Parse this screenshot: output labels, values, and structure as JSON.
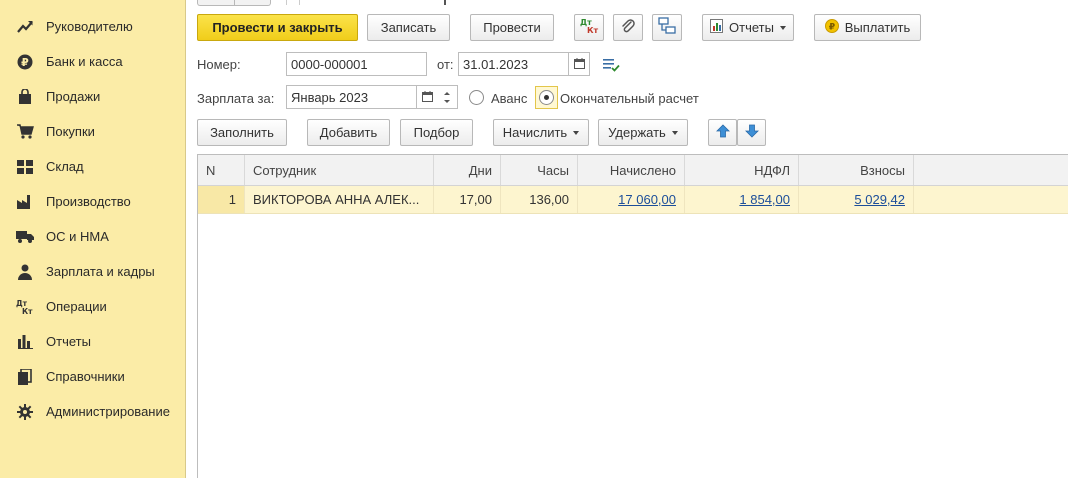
{
  "sidebar": {
    "items": [
      {
        "label": "Руководителю",
        "icon": "trend-chart-icon"
      },
      {
        "label": "Банк и касса",
        "icon": "ruble-coin-icon"
      },
      {
        "label": "Продажи",
        "icon": "shopping-bag-icon"
      },
      {
        "label": "Покупки",
        "icon": "shopping-cart-icon"
      },
      {
        "label": "Склад",
        "icon": "warehouse-grid-icon"
      },
      {
        "label": "Производство",
        "icon": "factory-icon"
      },
      {
        "label": "ОС и НМА",
        "icon": "truck-icon"
      },
      {
        "label": "Зарплата и кадры",
        "icon": "person-icon"
      },
      {
        "label": "Операции",
        "icon": "debit-credit-icon"
      },
      {
        "label": "Отчеты",
        "icon": "bar-chart-icon"
      },
      {
        "label": "Справочники",
        "icon": "books-icon"
      },
      {
        "label": "Администрирование",
        "icon": "gear-icon"
      }
    ]
  },
  "toolbar": {
    "post_close_label": "Провести и закрыть",
    "save_label": "Записать",
    "post_label": "Провести",
    "dtkt_icon": "debit-credit-icon",
    "attach_icon": "paperclip-icon",
    "structure_icon": "document-structure-icon",
    "reports_label": "Отчеты",
    "pay_label": "Выплатить"
  },
  "form": {
    "number_label": "Номер:",
    "number_value": "0000-000001",
    "date_label": "от:",
    "date_value": "31.01.2023",
    "salary_label": "Зарплата за:",
    "salary_value": "Январь 2023",
    "advance_label": "Аванс",
    "final_label": "Окончательный расчет"
  },
  "table_toolbar": {
    "fill_label": "Заполнить",
    "add_label": "Добавить",
    "select_label": "Подбор",
    "accrue_label": "Начислить",
    "deduct_label": "Удержать"
  },
  "table": {
    "headers": [
      "N",
      "Сотрудник",
      "Дни",
      "Часы",
      "Начислено",
      "НДФЛ",
      "Взносы"
    ],
    "rows": [
      {
        "n": "1",
        "employee": "ВИКТОРОВА АННА АЛЕК...",
        "days": "17,00",
        "hours": "136,00",
        "accrued": "17 060,00",
        "ndfl": "1 854,00",
        "contributions": "5 029,42"
      }
    ]
  },
  "colors": {
    "sidebar_bg": "#fbeca7",
    "primary_button": "#f5d726",
    "selected_row": "#fdf5cf",
    "link": "#1c4e9a"
  }
}
